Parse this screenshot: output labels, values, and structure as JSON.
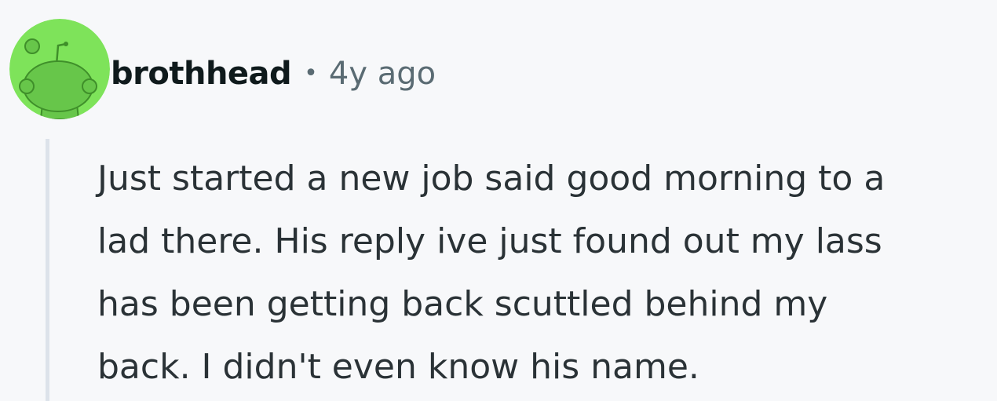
{
  "comment": {
    "author": "brothhead",
    "separator": "•",
    "age": "4y ago",
    "avatar_icon": "snoo-avatar-icon",
    "avatar_color": "#7ee35a",
    "body_lines": [
      "Just started a new job said good morning to a",
      "lad there. His reply ive just found out my lass",
      "has been getting back scuttled behind my",
      "back. I didn't even know his name."
    ]
  }
}
